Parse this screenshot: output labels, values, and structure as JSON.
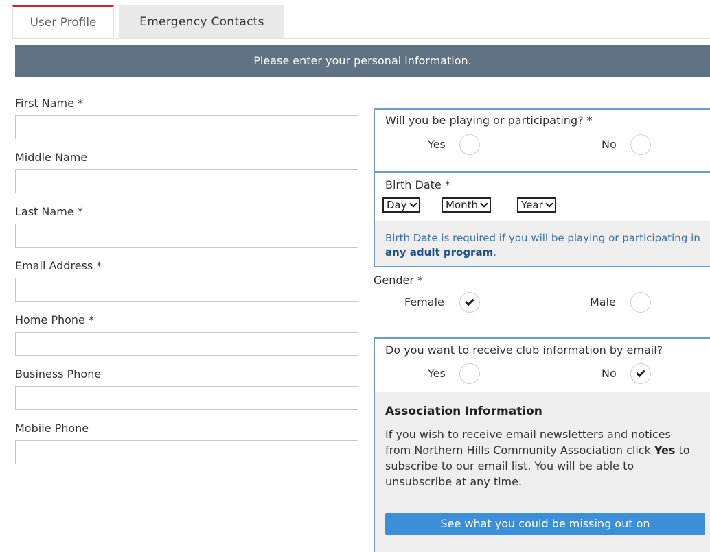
{
  "tabs": {
    "user_profile": "User Profile",
    "emergency_contacts": "Emergency Contacts"
  },
  "banner": "Please enter your personal information.",
  "form": {
    "first_name": {
      "label": "First Name *",
      "value": ""
    },
    "middle_name": {
      "label": "Middle Name",
      "value": ""
    },
    "last_name": {
      "label": "Last Name *",
      "value": ""
    },
    "email": {
      "label": "Email Address *",
      "value": ""
    },
    "home_phone": {
      "label": "Home Phone *",
      "value": ""
    },
    "business_phone": {
      "label": "Business Phone",
      "value": ""
    },
    "mobile_phone": {
      "label": "Mobile Phone",
      "value": ""
    }
  },
  "participating": {
    "question": "Will you be playing or participating? *",
    "yes_label": "Yes",
    "no_label": "No",
    "selected": "none"
  },
  "birth_date": {
    "label": "Birth Date *",
    "day": "Day",
    "month": "Month",
    "year": "Year",
    "note_prefix": "Birth Date is required if you will be playing or participating in ",
    "note_bold": "any adult program",
    "note_suffix": "."
  },
  "gender": {
    "label": "Gender *",
    "female_label": "Female",
    "male_label": "Male",
    "selected": "Female"
  },
  "club_email": {
    "question": "Do you want to receive club information by email?",
    "yes_label": "Yes",
    "no_label": "No",
    "selected": "No"
  },
  "association": {
    "title": "Association Information",
    "body_prefix": "If you wish to receive email newsletters and notices from Northern Hills Community Association click ",
    "body_bold": "Yes",
    "body_suffix": " to subscribe to our email list. You will be able to unsubscribe at any time.",
    "button_label": "See what you could be missing out on"
  },
  "colors": {
    "banner_bg": "#5f7385",
    "panel_border": "#6d9cc8",
    "tab_accent": "#cc2a2a",
    "button_bg": "#3d8ed8",
    "note_text": "#3d6f9e"
  }
}
